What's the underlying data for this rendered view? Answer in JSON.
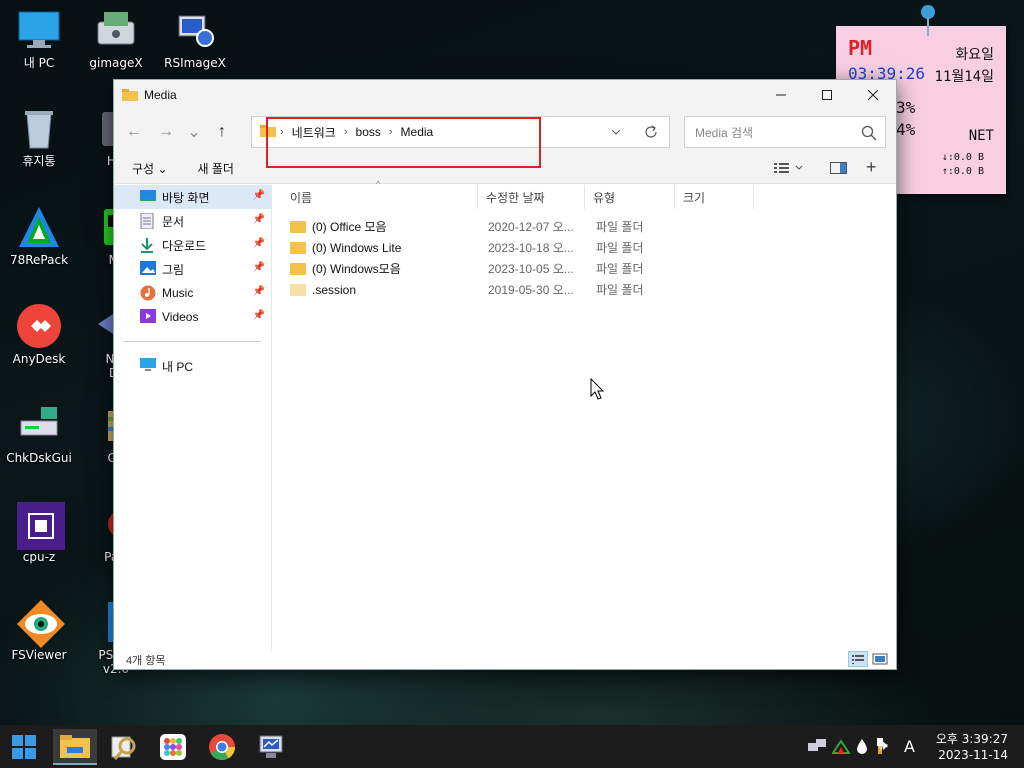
{
  "desktop": {
    "icons": [
      {
        "label": "내 PC",
        "icon": "computer-icon"
      },
      {
        "label": "gimageX",
        "icon": "gimagex-icon"
      },
      {
        "label": "RSImageX",
        "icon": "rsimagex-icon"
      },
      {
        "label": "휴지통",
        "icon": "recycle-bin-icon"
      },
      {
        "label": "HD",
        "icon": "hd-icon"
      },
      {
        "label": "78RePack",
        "icon": "repack-icon"
      },
      {
        "label": "M-",
        "icon": "m-icon"
      },
      {
        "label": "AnyDesk",
        "icon": "anydesk-icon"
      },
      {
        "label": "Net",
        "label2": "Dr",
        "icon": "net-drive-icon"
      },
      {
        "label": "ChkDskGui",
        "icon": "chkdsk-icon"
      },
      {
        "label": "On",
        "icon": "on-icon"
      },
      {
        "label": "cpu-z",
        "icon": "cpuz-icon"
      },
      {
        "label": "Part",
        "icon": "partition-icon"
      },
      {
        "label": "FSViewer",
        "icon": "fsviewer-icon"
      },
      {
        "label": "PS BR",
        "label2": "v2.0",
        "icon": "psbr-icon"
      }
    ]
  },
  "sticky": {
    "ampm": "PM",
    "time": "03:39:26",
    "weekday": "화요일",
    "date": "11월14일",
    "pct1": "3%",
    "pct2": "4%",
    "net": "NET",
    "down": "↓:0.0 B",
    "up": "↑:0.0 B"
  },
  "window": {
    "title": "Media",
    "nav": {
      "back": "←",
      "forward": "→",
      "recent": "⌄",
      "up": "↑"
    },
    "address": {
      "crumbs": [
        "네트워크",
        "boss",
        "Media"
      ],
      "sep": "›"
    },
    "search": {
      "placeholder": "Media 검색"
    },
    "commands": {
      "organize": "구성",
      "organize_arrow": "⌄",
      "new_folder": "새 폴더",
      "add": "+"
    },
    "navpane": {
      "quick": [
        {
          "label": "바탕 화면",
          "icon": "desktop-icon",
          "pinned": true,
          "selected": true
        },
        {
          "label": "문서",
          "icon": "documents-icon",
          "pinned": true
        },
        {
          "label": "다운로드",
          "icon": "downloads-icon",
          "pinned": true
        },
        {
          "label": "그림",
          "icon": "pictures-icon",
          "pinned": true
        },
        {
          "label": "Music",
          "icon": "music-icon",
          "pinned": true
        },
        {
          "label": "Videos",
          "icon": "videos-icon",
          "pinned": true
        }
      ],
      "pc": {
        "label": "내 PC",
        "icon": "computer-icon"
      }
    },
    "columns": [
      "이름",
      "수정한 날짜",
      "유형",
      "크기"
    ],
    "files": [
      {
        "name": "(0) Office 모음",
        "date": "2020-12-07 오...",
        "type": "파일 폴더",
        "size": "",
        "hidden": false
      },
      {
        "name": "(0) Windows Lite",
        "date": "2023-10-18 오...",
        "type": "파일 폴더",
        "size": "",
        "hidden": false
      },
      {
        "name": "(0) Windows모음",
        "date": "2023-10-05 오...",
        "type": "파일 폴더",
        "size": "",
        "hidden": false
      },
      {
        "name": ".session",
        "date": "2019-05-30 오...",
        "type": "파일 폴더",
        "size": "",
        "hidden": true
      }
    ],
    "status": "4개 항목"
  },
  "taskbar": {
    "clock_time": "오후 3:39:27",
    "clock_date": "2023-11-14",
    "ime": "A",
    "volume": "🕪"
  },
  "colors": {
    "folder": "#f2c24a",
    "folder_hidden": "#f6e2a6",
    "selection": "#dbe8f6",
    "highlight_box": "#e02020",
    "accent": "#1e7fd8"
  }
}
